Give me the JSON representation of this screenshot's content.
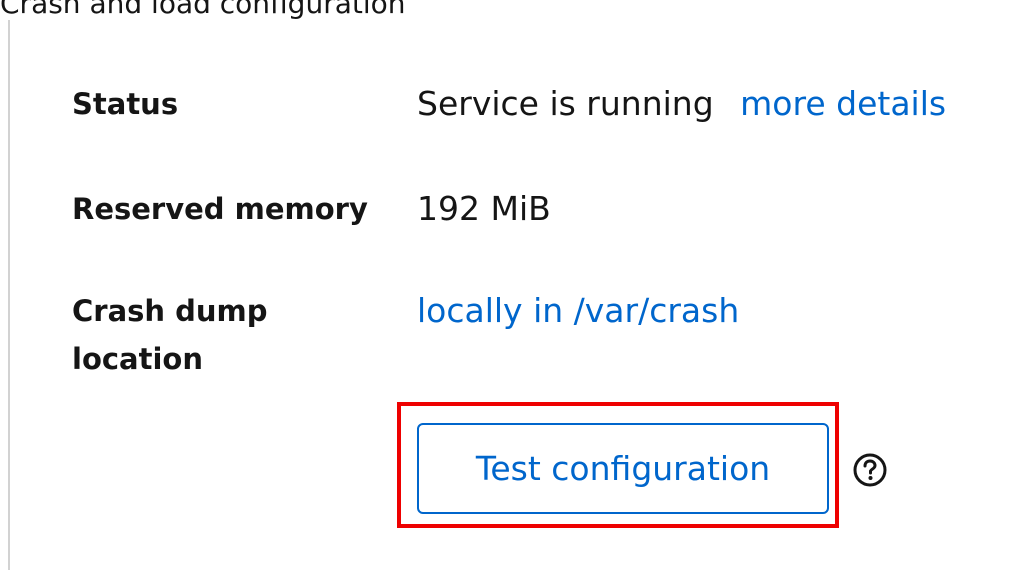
{
  "top_clip": "Crash and load configuration",
  "details": {
    "status": {
      "label": "Status",
      "value": "Service is running",
      "link": "more details"
    },
    "reserved_memory": {
      "label": "Reserved memory",
      "value": "192 MiB"
    },
    "crash_dump_location": {
      "label_line1": "Crash dump",
      "label_line2": "location",
      "value": "locally in /var/crash"
    }
  },
  "actions": {
    "test_button": "Test configuration",
    "help_icon": "question-circle-icon"
  },
  "colors": {
    "link": "#0066cc",
    "highlight": "#ee0000",
    "text": "#151515"
  }
}
